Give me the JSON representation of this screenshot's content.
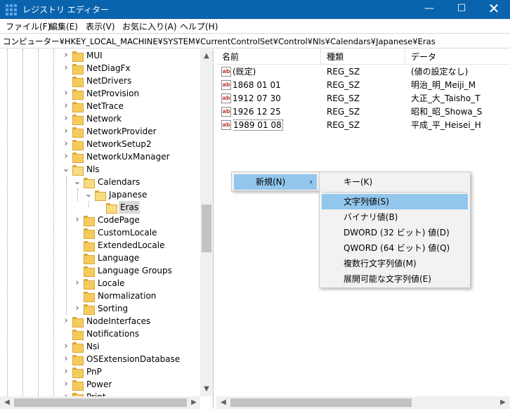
{
  "window": {
    "title": "レジストリ エディター"
  },
  "window_controls": {
    "minimize": "—",
    "maximize": "☐",
    "close": "✕"
  },
  "menu": [
    "ファイル(F)",
    "編集(E)",
    "表示(V)",
    "お気に入り(A)",
    "ヘルプ(H)"
  ],
  "address": "コンピューター¥HKEY_LOCAL_MACHINE¥SYSTEM¥CurrentControlSet¥Control¥Nls¥Calendars¥Japanese¥Eras",
  "tree": [
    {
      "label": "MUI",
      "expanded": false,
      "has_children": true
    },
    {
      "label": "NetDiagFx",
      "expanded": false,
      "has_children": true
    },
    {
      "label": "NetDrivers",
      "expanded": false,
      "has_children": false
    },
    {
      "label": "NetProvision",
      "expanded": false,
      "has_children": true
    },
    {
      "label": "NetTrace",
      "expanded": false,
      "has_children": true
    },
    {
      "label": "Network",
      "expanded": false,
      "has_children": true
    },
    {
      "label": "NetworkProvider",
      "expanded": false,
      "has_children": true
    },
    {
      "label": "NetworkSetup2",
      "expanded": false,
      "has_children": true
    },
    {
      "label": "NetworkUxManager",
      "expanded": false,
      "has_children": true
    },
    {
      "label": "Nls",
      "expanded": true,
      "has_children": true
    },
    {
      "label": "Calendars",
      "expanded": true,
      "has_children": true
    },
    {
      "label": "Japanese",
      "expanded": true,
      "has_children": true
    },
    {
      "label": "Eras",
      "expanded": false,
      "has_children": false,
      "selected": true
    },
    {
      "label": "CodePage",
      "expanded": false,
      "has_children": true
    },
    {
      "label": "CustomLocale",
      "expanded": false,
      "has_children": false
    },
    {
      "label": "ExtendedLocale",
      "expanded": false,
      "has_children": false
    },
    {
      "label": "Language",
      "expanded": false,
      "has_children": false
    },
    {
      "label": "Language Groups",
      "expanded": false,
      "has_children": false
    },
    {
      "label": "Locale",
      "expanded": false,
      "has_children": true
    },
    {
      "label": "Normalization",
      "expanded": false,
      "has_children": false
    },
    {
      "label": "Sorting",
      "expanded": false,
      "has_children": true
    },
    {
      "label": "NodeInterfaces",
      "expanded": false,
      "has_children": true
    },
    {
      "label": "Notifications",
      "expanded": false,
      "has_children": false
    },
    {
      "label": "Nsi",
      "expanded": false,
      "has_children": true
    },
    {
      "label": "OSExtensionDatabase",
      "expanded": false,
      "has_children": true
    },
    {
      "label": "PnP",
      "expanded": false,
      "has_children": true
    },
    {
      "label": "Power",
      "expanded": false,
      "has_children": true
    },
    {
      "label": "Print",
      "expanded": false,
      "has_children": true
    }
  ],
  "list": {
    "columns": [
      "名前",
      "種類",
      "データ"
    ],
    "icon_text": "ab",
    "rows": [
      {
        "name": "(既定)",
        "type": "REG_SZ",
        "data": "(値の設定なし)"
      },
      {
        "name": "1868 01 01",
        "type": "REG_SZ",
        "data": "明治_明_Meiji_M"
      },
      {
        "name": "1912 07 30",
        "type": "REG_SZ",
        "data": "大正_大_Taisho_T"
      },
      {
        "name": "1926 12 25",
        "type": "REG_SZ",
        "data": "昭和_昭_Showa_S"
      },
      {
        "name": "1989 01 08",
        "type": "REG_SZ",
        "data": "平成_平_Heisei_H",
        "focused": true
      }
    ]
  },
  "context_menu": {
    "new_label": "新規(N)",
    "arrow": "›"
  },
  "submenu": [
    {
      "label": "キー(K)"
    },
    {
      "label": "文字列値(S)",
      "highlighted": true
    },
    {
      "label": "バイナリ値(B)"
    },
    {
      "label": "DWORD (32 ビット) 値(D)"
    },
    {
      "label": "QWORD (64 ビット) 値(Q)"
    },
    {
      "label": "複数行文字列値(M)"
    },
    {
      "label": "展開可能な文字列値(E)"
    }
  ],
  "scroll_arrows": {
    "up": "▲",
    "down": "▼",
    "left": "◀",
    "right": "▶"
  },
  "colors": {
    "titlebar": "#0a64ad",
    "highlight": "#93c6ec",
    "selected": "#d9d9d9"
  }
}
